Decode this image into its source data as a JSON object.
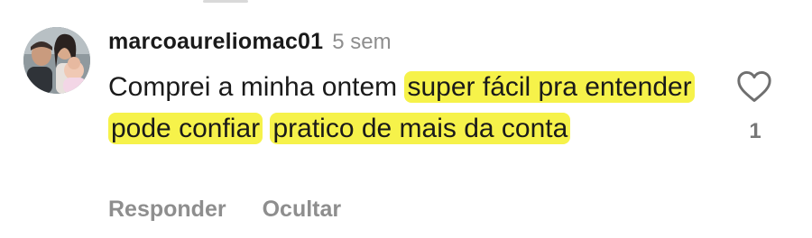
{
  "comment": {
    "username": "marcoaureliomac01",
    "timestamp": "5 sem",
    "text_segments": [
      {
        "text": "Comprei a minha ontem ",
        "highlighted": false
      },
      {
        "text": "super fácil pra entender",
        "highlighted": true
      },
      {
        "text": " ",
        "highlighted": false
      },
      {
        "text": "pode confiar",
        "highlighted": true
      },
      {
        "text": " ",
        "highlighted": false
      },
      {
        "text": "pratico de mais da conta",
        "highlighted": true
      }
    ],
    "like_count": "1",
    "actions": {
      "reply_label": "Responder",
      "hide_label": "Ocultar"
    },
    "icons": {
      "like": "heart-icon",
      "avatar": "avatar-photo"
    },
    "colors": {
      "highlight": "#f6f24a",
      "muted_text": "#8e8e8e",
      "text": "#1a1a1a"
    }
  }
}
